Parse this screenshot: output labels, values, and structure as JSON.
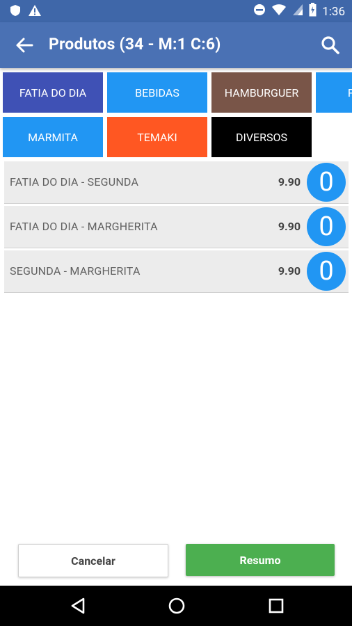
{
  "status_bar": {
    "time": "1:36",
    "icons": [
      "shield-icon",
      "warning-icon",
      "do-not-disturb-icon",
      "wifi-icon",
      "signal-icon",
      "battery-icon"
    ]
  },
  "app_bar": {
    "title": "Produtos  (34 - M:1 C:6)",
    "back_icon": "arrow-back-icon",
    "search_icon": "search-icon"
  },
  "categories": [
    {
      "label": "FATIA DO DIA",
      "color": "#3f51b5"
    },
    {
      "label": "BEBIDAS",
      "color": "#2196f3"
    },
    {
      "label": "HAMBURGUER",
      "color": "#795548"
    },
    {
      "label": "P",
      "color": "#2196f3"
    },
    {
      "label": "MARMITA",
      "color": "#2196f3"
    },
    {
      "label": "TEMAKI",
      "color": "#ff5722"
    },
    {
      "label": "DIVERSOS",
      "color": "#000000"
    }
  ],
  "products": [
    {
      "name": "FATIA DO DIA - SEGUNDA",
      "price": "9.90",
      "qty": "0"
    },
    {
      "name": "FATIA DO DIA - MARGHERITA",
      "price": "9.90",
      "qty": "0"
    },
    {
      "name": "SEGUNDA - MARGHERITA",
      "price": "9.90",
      "qty": "0"
    }
  ],
  "footer": {
    "cancel_label": "Cancelar",
    "resumo_label": "Resumo"
  },
  "nav_bar": {
    "icons": [
      "back-triangle-icon",
      "home-circle-icon",
      "recents-square-icon"
    ]
  }
}
